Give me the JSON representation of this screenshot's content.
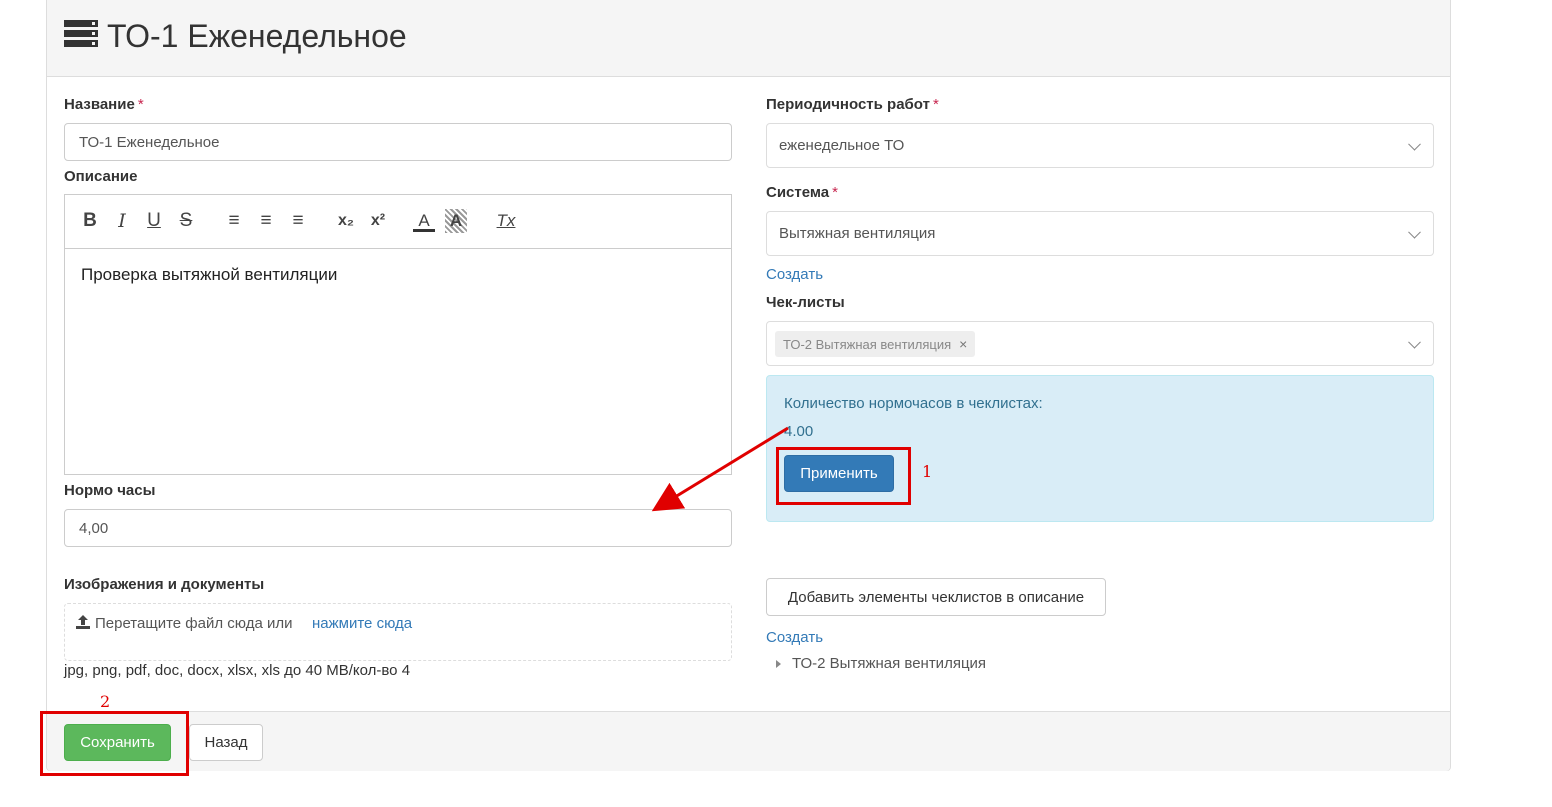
{
  "header": {
    "title": "ТО-1 Еженедельное",
    "icon": "server-list-icon"
  },
  "left": {
    "name_label": "Название",
    "name_value": "ТО-1 Еженедельное",
    "required_mark": "*",
    "description_label": "Описание",
    "editor": {
      "toolbar": [
        {
          "name": "bold-icon",
          "glyph": "B"
        },
        {
          "name": "italic-icon",
          "glyph": "I"
        },
        {
          "name": "underline-icon",
          "glyph": "U"
        },
        {
          "name": "strikethrough-icon",
          "glyph": "S"
        },
        {
          "name": "ordered-list-icon",
          "glyph": "≡"
        },
        {
          "name": "bullet-list-icon",
          "glyph": "≡"
        },
        {
          "name": "check-list-icon",
          "glyph": "≡"
        },
        {
          "name": "subscript-icon",
          "glyph": "x₂"
        },
        {
          "name": "superscript-icon",
          "glyph": "x²"
        },
        {
          "name": "text-color-icon",
          "glyph": "A"
        },
        {
          "name": "highlight-icon",
          "glyph": "A"
        },
        {
          "name": "clear-format-icon",
          "glyph": "Tx"
        }
      ],
      "content": "Проверка вытяжной вентиляции"
    },
    "hours_label": "Нормо часы",
    "hours_value": "4,00",
    "files_label": "Изображения и документы",
    "dropzone_text": "Перетащите файл сюда или",
    "dropzone_link": "нажмите сюда",
    "files_hint": "jpg, png, pdf, doc, docx, xlsx, xls до 40 MB/кол-во 4"
  },
  "right": {
    "period_label": "Периодичность работ",
    "period_value": "еженедельное ТО",
    "system_label": "Система",
    "system_value": "Вытяжная вентиляция",
    "create_link": "Создать",
    "checklists_label": "Чек-листы",
    "checklist_tag": "ТО-2 Вытяжная вентиляция",
    "info_title": "Количество нормочасов в чеклистах:",
    "info_value": "4.00",
    "apply_button": "Применить",
    "add_items_button": "Добавить элементы чеклистов в описание",
    "create_link_2": "Создать",
    "tree_item": "ТО-2 Вытяжная вентиляция"
  },
  "footer": {
    "save_button": "Сохранить",
    "back_button": "Назад"
  },
  "annotations": {
    "label_1": "1",
    "label_2": "2",
    "color": "#e00000"
  },
  "colors": {
    "primary": "#337ab7",
    "success": "#5cb85c",
    "info_bg": "#d9edf7",
    "annotation": "#e00000"
  }
}
